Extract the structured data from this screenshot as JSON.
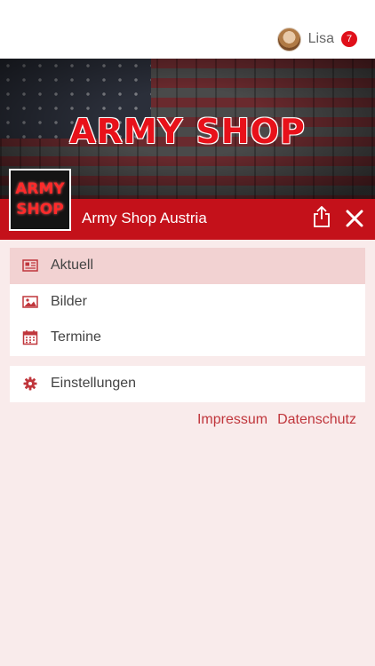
{
  "header": {
    "user_name": "Lisa",
    "notification_count": "7"
  },
  "banner": {
    "title": "ARMY SHOP",
    "logo_text_line1": "ARMY",
    "logo_text_line2": "SHOP"
  },
  "shop": {
    "name": "Army Shop Austria"
  },
  "menu": {
    "items": [
      {
        "label": "Aktuell",
        "icon": "newspaper-icon",
        "active": true
      },
      {
        "label": "Bilder",
        "icon": "image-icon",
        "active": false
      },
      {
        "label": "Termine",
        "icon": "calendar-icon",
        "active": false
      }
    ],
    "settings": {
      "label": "Einstellungen",
      "icon": "gear-icon"
    }
  },
  "footer": {
    "impressum": "Impressum",
    "datenschutz": "Datenschutz"
  },
  "colors": {
    "accent": "#c4111a",
    "icon": "#c0363c",
    "active_bg": "#f2d2d2",
    "page_bg": "#f9ebeb"
  }
}
